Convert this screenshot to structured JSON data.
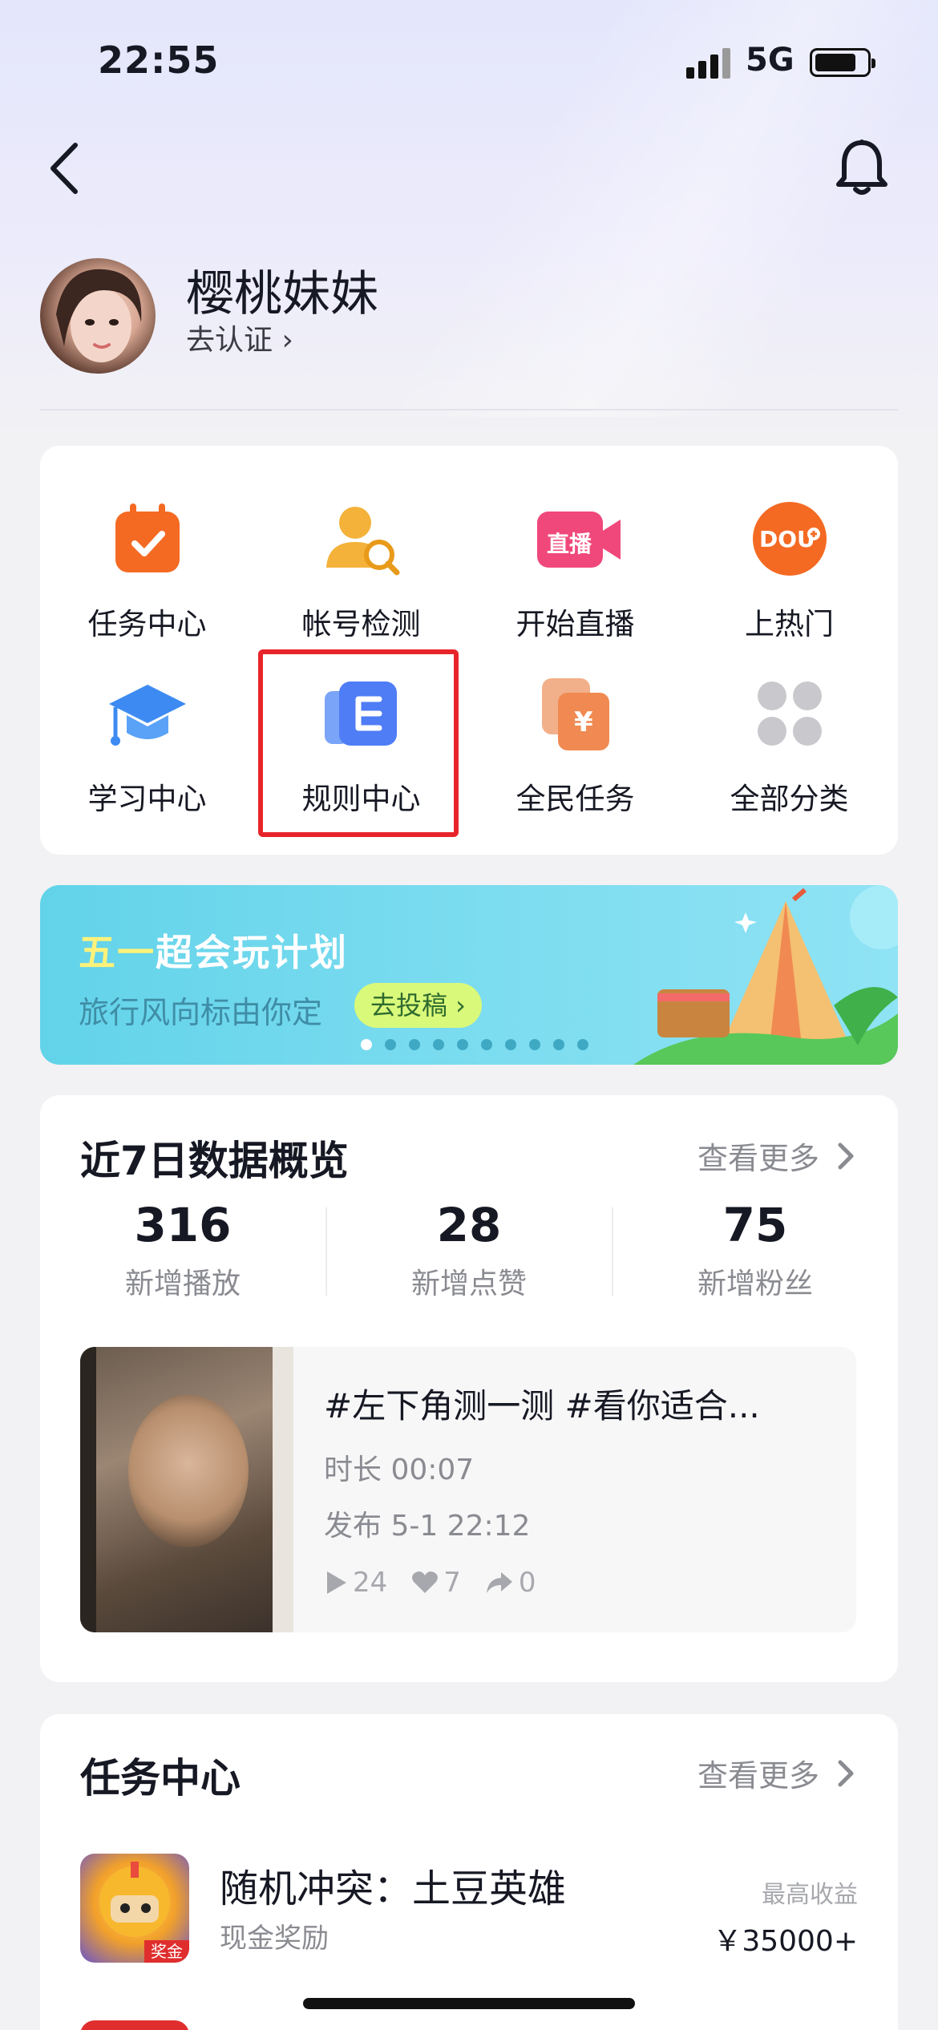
{
  "status_bar": {
    "time": "22:55",
    "network": "5G"
  },
  "profile": {
    "name": "樱桃妹妹",
    "verify_label": "去认证 ›"
  },
  "tools": [
    {
      "label": "任务中心",
      "icon": "task-calendar-icon"
    },
    {
      "label": "帐号检测",
      "icon": "account-check-icon"
    },
    {
      "label": "开始直播",
      "icon": "live-camera-icon"
    },
    {
      "label": "上热门",
      "icon": "dou-plus-icon"
    },
    {
      "label": "学习中心",
      "icon": "graduation-cap-icon"
    },
    {
      "label": "规则中心",
      "icon": "rules-book-icon"
    },
    {
      "label": "全民任务",
      "icon": "yuan-cards-icon"
    },
    {
      "label": "全部分类",
      "icon": "all-categories-icon"
    }
  ],
  "banner": {
    "title_highlight": "五一",
    "title_rest": "超会玩计划",
    "subtitle": "旅行风向标由你定",
    "button": "去投稿 ›",
    "slide_count": 10,
    "active_slide": 1
  },
  "overview": {
    "title": "近7日数据概览",
    "more": "查看更多",
    "stats": [
      {
        "value": "316",
        "label": "新增播放"
      },
      {
        "value": "28",
        "label": "新增点赞"
      },
      {
        "value": "75",
        "label": "新增粉丝"
      }
    ],
    "video": {
      "title": "#左下角测一测 #看你适合...",
      "duration": "时长 00:07",
      "published": "发布 5-1 22:12",
      "plays": "24",
      "likes": "7",
      "shares": "0"
    }
  },
  "tasks": {
    "title": "任务中心",
    "more": "查看更多",
    "items": [
      {
        "name": "随机冲突：土豆英雄",
        "sub": "现金奖励",
        "reward_caption": "最高收益",
        "reward": "￥35000+",
        "icon_tag": "奖金"
      }
    ]
  },
  "colors": {
    "accent_red": "#e8242b",
    "brand_blue": "#4f7df5",
    "orange": "#f46a23",
    "pink": "#f0487a"
  }
}
